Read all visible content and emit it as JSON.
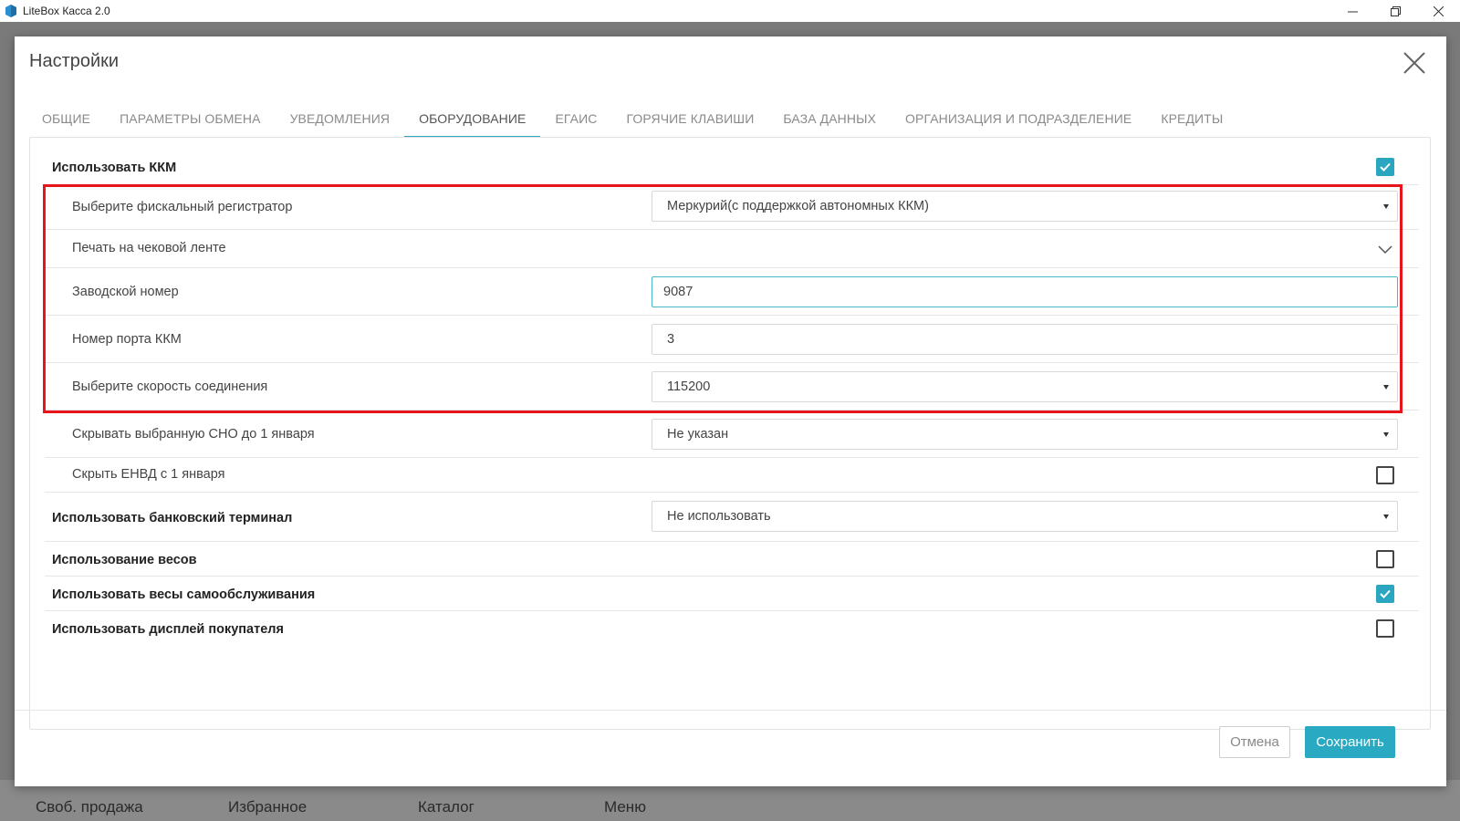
{
  "window": {
    "title": "LiteBox Касса 2.0",
    "controls": [
      "minimize-icon",
      "restore-icon",
      "close-icon"
    ]
  },
  "background_nav": {
    "items": [
      "Своб. продажа",
      "Избранное",
      "Каталог",
      "Меню"
    ]
  },
  "dialog": {
    "title": "Настройки",
    "close_icon": "close-icon"
  },
  "tabs": [
    {
      "label": "ОБЩИЕ",
      "active": false
    },
    {
      "label": "ПАРАМЕТРЫ ОБМЕНА",
      "active": false
    },
    {
      "label": "УВЕДОМЛЕНИЯ",
      "active": false
    },
    {
      "label": "ОБОРУДОВАНИЕ",
      "active": true
    },
    {
      "label": "ЕГАИС",
      "active": false
    },
    {
      "label": "ГОРЯЧИЕ КЛАВИШИ",
      "active": false
    },
    {
      "label": "БАЗА ДАННЫХ",
      "active": false
    },
    {
      "label": "ОРГАНИЗАЦИЯ И ПОДРАЗДЕЛЕНИЕ",
      "active": false
    },
    {
      "label": "КРЕДИТЫ",
      "active": false
    }
  ],
  "settings": {
    "use_kkm": {
      "label": "Использовать ККМ",
      "checked": true
    },
    "fiscal_registrar": {
      "label": "Выберите фискальный регистратор",
      "value": "Меркурий(с поддержкой автономных ККМ)"
    },
    "print_on_tape": {
      "label": "Печать на чековой ленте"
    },
    "serial_number": {
      "label": "Заводской номер",
      "value": "9087"
    },
    "port_number": {
      "label": "Номер порта ККМ",
      "value": "3"
    },
    "connection_speed": {
      "label": "Выберите скорость соединения",
      "value": "115200"
    },
    "hide_sno": {
      "label": "Скрывать выбранную СНО до 1 января",
      "value": "Не указан"
    },
    "hide_envd": {
      "label": "Скрыть ЕНВД с 1 января",
      "checked": false
    },
    "bank_terminal": {
      "label": "Использовать банковский терминал",
      "value": "Не использовать"
    },
    "use_scales": {
      "label": "Использование весов",
      "checked": false
    },
    "self_service_scales": {
      "label": "Использовать весы самообслуживания",
      "checked": true
    },
    "customer_display": {
      "label": "Использовать дисплей покупателя",
      "checked": false
    }
  },
  "footer": {
    "cancel_label": "Отмена",
    "save_label": "Сохранить"
  },
  "colors": {
    "accent": "#29a9c2",
    "highlight_frame": "#e8161c",
    "backdrop": "#7a7a7a"
  }
}
